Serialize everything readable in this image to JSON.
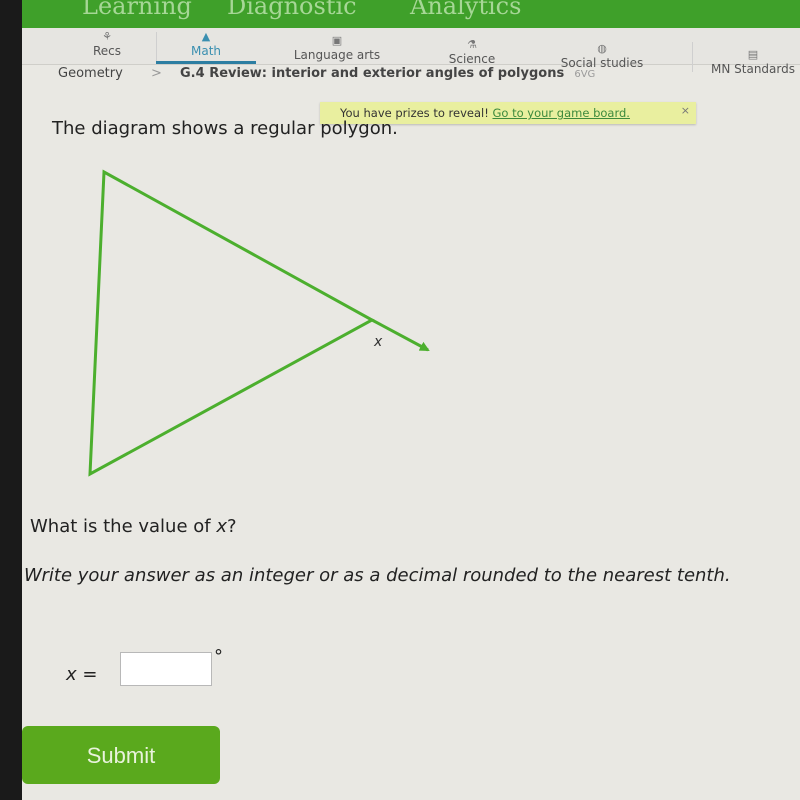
{
  "header": {
    "tabs": [
      "Learning",
      "Diagnostic",
      "Analytics"
    ]
  },
  "subnav": {
    "items": [
      {
        "label": "Recs",
        "icon": "recs-icon",
        "active": false
      },
      {
        "label": "Math",
        "icon": "math-icon",
        "active": true
      },
      {
        "label": "Language arts",
        "icon": "book-icon",
        "active": false
      },
      {
        "label": "Science",
        "icon": "science-icon",
        "active": false
      },
      {
        "label": "Social studies",
        "icon": "globe-icon",
        "active": false
      },
      {
        "label": "MN Standards",
        "icon": "standards-icon",
        "active": false
      }
    ]
  },
  "breadcrumb": {
    "parent": "Geometry",
    "separator": ">",
    "skill": "G.4 Review: interior and exterior angles of polygons",
    "skill_code": "6VG"
  },
  "prize_banner": {
    "text": "You have prizes to reveal!",
    "link": "Go to your game board.",
    "close": "×"
  },
  "question": {
    "prompt": "The diagram shows a regular polygon.",
    "diagram_label": "x",
    "ask": "What is the value of ",
    "ask_var": "x",
    "ask_end": "?",
    "instruction": "Write your answer as an integer or as a decimal rounded to the nearest tenth.",
    "answer_label_var": "x",
    "answer_label_eq": " =",
    "answer_value": "",
    "unit": "°"
  },
  "colors": {
    "brand_green": "#3fa02a",
    "diagram_green": "#4caf2e",
    "submit_green": "#5aa91d",
    "active_tab": "#2d7ea2"
  },
  "actions": {
    "submit": "Submit"
  }
}
